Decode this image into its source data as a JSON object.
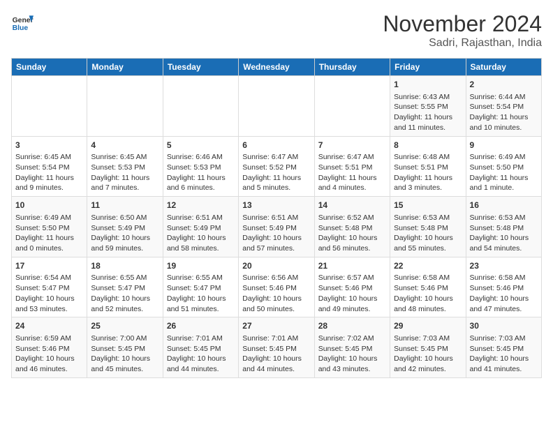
{
  "header": {
    "logo_line1": "General",
    "logo_line2": "Blue",
    "title": "November 2024",
    "subtitle": "Sadri, Rajasthan, India"
  },
  "weekdays": [
    "Sunday",
    "Monday",
    "Tuesday",
    "Wednesday",
    "Thursday",
    "Friday",
    "Saturday"
  ],
  "weeks": [
    [
      {
        "day": "",
        "info": ""
      },
      {
        "day": "",
        "info": ""
      },
      {
        "day": "",
        "info": ""
      },
      {
        "day": "",
        "info": ""
      },
      {
        "day": "",
        "info": ""
      },
      {
        "day": "1",
        "info": "Sunrise: 6:43 AM\nSunset: 5:55 PM\nDaylight: 11 hours and 11 minutes."
      },
      {
        "day": "2",
        "info": "Sunrise: 6:44 AM\nSunset: 5:54 PM\nDaylight: 11 hours and 10 minutes."
      }
    ],
    [
      {
        "day": "3",
        "info": "Sunrise: 6:45 AM\nSunset: 5:54 PM\nDaylight: 11 hours and 9 minutes."
      },
      {
        "day": "4",
        "info": "Sunrise: 6:45 AM\nSunset: 5:53 PM\nDaylight: 11 hours and 7 minutes."
      },
      {
        "day": "5",
        "info": "Sunrise: 6:46 AM\nSunset: 5:53 PM\nDaylight: 11 hours and 6 minutes."
      },
      {
        "day": "6",
        "info": "Sunrise: 6:47 AM\nSunset: 5:52 PM\nDaylight: 11 hours and 5 minutes."
      },
      {
        "day": "7",
        "info": "Sunrise: 6:47 AM\nSunset: 5:51 PM\nDaylight: 11 hours and 4 minutes."
      },
      {
        "day": "8",
        "info": "Sunrise: 6:48 AM\nSunset: 5:51 PM\nDaylight: 11 hours and 3 minutes."
      },
      {
        "day": "9",
        "info": "Sunrise: 6:49 AM\nSunset: 5:50 PM\nDaylight: 11 hours and 1 minute."
      }
    ],
    [
      {
        "day": "10",
        "info": "Sunrise: 6:49 AM\nSunset: 5:50 PM\nDaylight: 11 hours and 0 minutes."
      },
      {
        "day": "11",
        "info": "Sunrise: 6:50 AM\nSunset: 5:49 PM\nDaylight: 10 hours and 59 minutes."
      },
      {
        "day": "12",
        "info": "Sunrise: 6:51 AM\nSunset: 5:49 PM\nDaylight: 10 hours and 58 minutes."
      },
      {
        "day": "13",
        "info": "Sunrise: 6:51 AM\nSunset: 5:49 PM\nDaylight: 10 hours and 57 minutes."
      },
      {
        "day": "14",
        "info": "Sunrise: 6:52 AM\nSunset: 5:48 PM\nDaylight: 10 hours and 56 minutes."
      },
      {
        "day": "15",
        "info": "Sunrise: 6:53 AM\nSunset: 5:48 PM\nDaylight: 10 hours and 55 minutes."
      },
      {
        "day": "16",
        "info": "Sunrise: 6:53 AM\nSunset: 5:48 PM\nDaylight: 10 hours and 54 minutes."
      }
    ],
    [
      {
        "day": "17",
        "info": "Sunrise: 6:54 AM\nSunset: 5:47 PM\nDaylight: 10 hours and 53 minutes."
      },
      {
        "day": "18",
        "info": "Sunrise: 6:55 AM\nSunset: 5:47 PM\nDaylight: 10 hours and 52 minutes."
      },
      {
        "day": "19",
        "info": "Sunrise: 6:55 AM\nSunset: 5:47 PM\nDaylight: 10 hours and 51 minutes."
      },
      {
        "day": "20",
        "info": "Sunrise: 6:56 AM\nSunset: 5:46 PM\nDaylight: 10 hours and 50 minutes."
      },
      {
        "day": "21",
        "info": "Sunrise: 6:57 AM\nSunset: 5:46 PM\nDaylight: 10 hours and 49 minutes."
      },
      {
        "day": "22",
        "info": "Sunrise: 6:58 AM\nSunset: 5:46 PM\nDaylight: 10 hours and 48 minutes."
      },
      {
        "day": "23",
        "info": "Sunrise: 6:58 AM\nSunset: 5:46 PM\nDaylight: 10 hours and 47 minutes."
      }
    ],
    [
      {
        "day": "24",
        "info": "Sunrise: 6:59 AM\nSunset: 5:46 PM\nDaylight: 10 hours and 46 minutes."
      },
      {
        "day": "25",
        "info": "Sunrise: 7:00 AM\nSunset: 5:45 PM\nDaylight: 10 hours and 45 minutes."
      },
      {
        "day": "26",
        "info": "Sunrise: 7:01 AM\nSunset: 5:45 PM\nDaylight: 10 hours and 44 minutes."
      },
      {
        "day": "27",
        "info": "Sunrise: 7:01 AM\nSunset: 5:45 PM\nDaylight: 10 hours and 44 minutes."
      },
      {
        "day": "28",
        "info": "Sunrise: 7:02 AM\nSunset: 5:45 PM\nDaylight: 10 hours and 43 minutes."
      },
      {
        "day": "29",
        "info": "Sunrise: 7:03 AM\nSunset: 5:45 PM\nDaylight: 10 hours and 42 minutes."
      },
      {
        "day": "30",
        "info": "Sunrise: 7:03 AM\nSunset: 5:45 PM\nDaylight: 10 hours and 41 minutes."
      }
    ]
  ]
}
